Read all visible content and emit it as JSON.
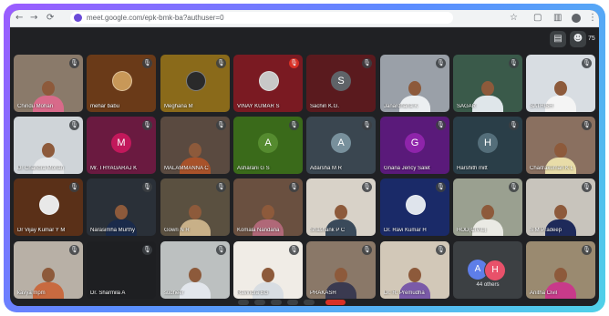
{
  "browser": {
    "url": "meet.google.com/epk-bmk-ba?authuser=0",
    "back_icon": "←",
    "forward_icon": "→",
    "reload_icon": "⟳"
  },
  "toolbar": {
    "participant_count": "75"
  },
  "tiles": [
    {
      "name": "Chindu Mohan",
      "kind": "video",
      "bg": "#8a7a6a",
      "body": "#d86a8a",
      "mic": "muted"
    },
    {
      "name": "mehar babu",
      "kind": "photo",
      "bg": "#6a3a18",
      "photo": "#c89858",
      "mic": "muted"
    },
    {
      "name": "Meghana M",
      "kind": "photo",
      "bg": "#8a6a1a",
      "photo": "#2a2a2a",
      "mic": "muted"
    },
    {
      "name": "VINAY KUMAR S",
      "kind": "photo",
      "bg": "#7a1a22",
      "photo": "#c8c8c8",
      "mic": "red"
    },
    {
      "name": "Sachin K.G.",
      "kind": "avatar",
      "bg": "#5a1a1e",
      "avatar": "#5f6368",
      "letter": "S",
      "mic": "muted"
    },
    {
      "name": "Janardhana K",
      "kind": "video",
      "bg": "#9aa0a8",
      "body": "#eceff1",
      "mic": "muted"
    },
    {
      "name": "SAGAR",
      "kind": "video",
      "bg": "#3a5a4a",
      "body": "#dfe6ea",
      "mic": "muted"
    },
    {
      "name": "SATHISH",
      "kind": "video",
      "bg": "#d8dde2",
      "body": "#f4f4f4",
      "mic": "muted"
    },
    {
      "name": "Dr Chandra Mohan",
      "kind": "video",
      "bg": "#cfd4d8",
      "body": "#e6e8ea",
      "mic": "muted"
    },
    {
      "name": "Mr. THYAGARAJ K",
      "kind": "avatar",
      "bg": "#6a1a40",
      "avatar": "#c2185b",
      "letter": "M",
      "mic": "muted"
    },
    {
      "name": "MALAMMANNA C",
      "kind": "video",
      "bg": "#5a4a40",
      "body": "#a8522a",
      "mic": "muted"
    },
    {
      "name": "Asharani G S",
      "kind": "avatar",
      "bg": "#3a6a1a",
      "avatar": "#558b2f",
      "letter": "A",
      "mic": "muted"
    },
    {
      "name": "Adarsha M R",
      "kind": "avatar",
      "bg": "#3a4650",
      "avatar": "#78909c",
      "letter": "A",
      "mic": "muted"
    },
    {
      "name": "Gnana Jency Salet",
      "kind": "avatar",
      "bg": "#5a1a7a",
      "avatar": "#8e24aa",
      "letter": "G",
      "mic": "muted"
    },
    {
      "name": "Harshith mitt",
      "kind": "avatar",
      "bg": "#2a3e48",
      "avatar": "#546e7a",
      "letter": "H",
      "mic": "muted"
    },
    {
      "name": "Chaitrakumari K L",
      "kind": "video",
      "bg": "#8a7060",
      "body": "#e8dca8",
      "mic": "muted"
    },
    {
      "name": "Dr Vijay Kumar Y M",
      "kind": "photo",
      "bg": "#5a3018",
      "photo": "#e8e8e8",
      "mic": "muted"
    },
    {
      "name": "Narasimha Murthy",
      "kind": "video",
      "bg": "#2a3038",
      "body": "#1a2a4a",
      "mic": "muted"
    },
    {
      "name": "Gowri N R",
      "kind": "video",
      "bg": "#5a5040",
      "body": "#c8b088",
      "mic": "muted"
    },
    {
      "name": "Komala Nandana",
      "kind": "video",
      "bg": "#6a5040",
      "body": "#b06878",
      "mic": "muted"
    },
    {
      "name": "Shashank P C",
      "kind": "video",
      "bg": "#d8d2c8",
      "body": "#3a4a5a",
      "mic": "muted"
    },
    {
      "name": "Dr. Ravi Kumar H",
      "kind": "photo",
      "bg": "#1a2a68",
      "photo": "#dfe4ec",
      "mic": "muted"
    },
    {
      "name": "HOD(CIVIL)",
      "kind": "video",
      "bg": "#9aa090",
      "body": "#eaeae4",
      "mic": "muted"
    },
    {
      "name": "S M Pradeep",
      "kind": "video",
      "bg": "#c8c4bc",
      "body": "#1e2a5a",
      "mic": "muted"
    },
    {
      "name": "kavya mpm",
      "kind": "video",
      "bg": "#b8b0a6",
      "body": "#c86a40",
      "mic": "muted"
    },
    {
      "name": "Dr. Sharmila A",
      "kind": "blank",
      "bg": "#1e1f22",
      "mic": "muted"
    },
    {
      "name": "sudheer",
      "kind": "video",
      "bg": "#bcc0c0",
      "body": "#e2e6ec",
      "mic": "muted"
    },
    {
      "name": "Ravindra BG",
      "kind": "video",
      "bg": "#f0ece6",
      "body": "#d8dde2",
      "mic": "muted"
    },
    {
      "name": "PRAKASH",
      "kind": "video",
      "bg": "#8a7868",
      "body": "#3a3a50",
      "mic": "muted"
    },
    {
      "name": "Dr. R. Premudha",
      "kind": "video",
      "bg": "#d2c8b8",
      "body": "#7a5aa8",
      "mic": "muted"
    },
    {
      "name": "44 others",
      "kind": "others",
      "bg": "#3c4043",
      "a1": "A",
      "a2": "H",
      "mic": "none"
    },
    {
      "name": "Anitha Civil",
      "kind": "video",
      "bg": "#9a8a70",
      "body": "#c83a8a",
      "mic": "muted"
    }
  ]
}
